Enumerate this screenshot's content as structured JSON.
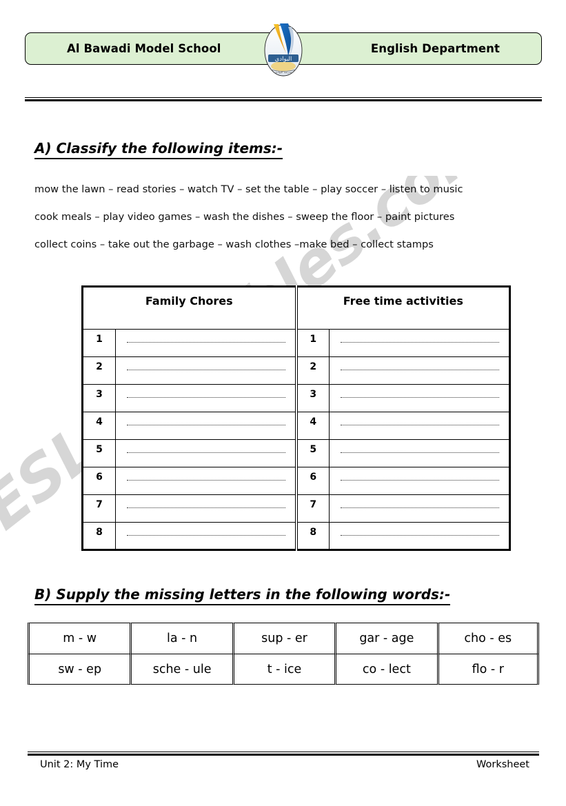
{
  "header": {
    "school_name": "Al Bawadi Model School",
    "department": "English Department",
    "logo_name": "school-crest-logo"
  },
  "watermark": {
    "text": "ESLprintables.com"
  },
  "section_a": {
    "heading": "A) Classify the following items:-",
    "item_lines": [
      "mow the lawn – read stories – watch TV – set the table – play soccer – listen to music",
      "cook meals – play video games – wash the dishes – sweep the floor – paint pictures",
      "collect coins – take out the garbage – wash clothes –make bed – collect stamps"
    ],
    "table": {
      "headers": [
        "Family Chores",
        "Free time activities"
      ],
      "row_numbers": [
        "1",
        "2",
        "3",
        "4",
        "5",
        "6",
        "7",
        "8"
      ],
      "answer_placeholder": ""
    }
  },
  "section_b": {
    "heading": "B) Supply the missing letters in the following words:-",
    "rows": [
      [
        "m - w",
        "la - n",
        "sup - er",
        "gar - age",
        "cho - es"
      ],
      [
        "sw - ep",
        "sche - ule",
        "t - ice",
        "co - lect",
        "flo - r"
      ]
    ]
  },
  "footer": {
    "unit": "Unit 2: My Time",
    "type": "Worksheet"
  },
  "colors": {
    "banner_fill": "#dcf0d2",
    "banner_border": "#000000",
    "text": "#000000",
    "watermark": "rgba(0,0,0,0.16)"
  }
}
